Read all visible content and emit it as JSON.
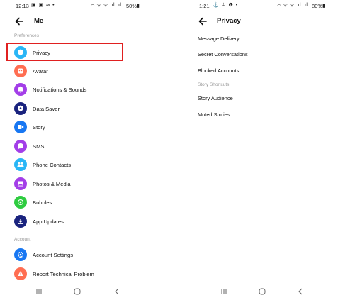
{
  "left": {
    "status": {
      "time": "12:13",
      "icons": "▣ ▣ ʍ •",
      "signal": "⌓ ᯤ ᯤ .ıl .ıl",
      "battery": "50%"
    },
    "appbar": {
      "title": "Me"
    },
    "sections": [
      {
        "header": "Preferences",
        "items": [
          {
            "label": "Privacy",
            "icon": "shield-icon",
            "color": "#29b6f6"
          },
          {
            "label": "Avatar",
            "icon": "avatar-icon",
            "color": "#ff6e52"
          },
          {
            "label": "Notifications & Sounds",
            "icon": "bell-icon",
            "color": "#a33ee8"
          },
          {
            "label": "Data Saver",
            "icon": "data-saver-icon",
            "color": "#1a237e"
          },
          {
            "label": "Story",
            "icon": "story-icon",
            "color": "#1877f2"
          },
          {
            "label": "SMS",
            "icon": "sms-icon",
            "color": "#a33ee8"
          },
          {
            "label": "Phone Contacts",
            "icon": "contacts-icon",
            "color": "#29b6f6"
          },
          {
            "label": "Photos & Media",
            "icon": "photo-icon",
            "color": "#a33ee8"
          },
          {
            "label": "Bubbles",
            "icon": "bubbles-icon",
            "color": "#2ecc40"
          },
          {
            "label": "App Updates",
            "icon": "download-icon",
            "color": "#1a237e"
          }
        ]
      },
      {
        "header": "Account",
        "items": [
          {
            "label": "Account Settings",
            "icon": "gear-icon",
            "color": "#1877f2"
          },
          {
            "label": "Report Technical Problem",
            "icon": "warning-icon",
            "color": "#ff6e52"
          }
        ]
      }
    ]
  },
  "right": {
    "status": {
      "time": "1:21",
      "icons": "⚓ ⇣ ❶ •",
      "signal": "⌓ ᯤ ᯤ .ıl .ıl",
      "battery": "80%"
    },
    "appbar": {
      "title": "Privacy"
    },
    "items": [
      "Message Delivery",
      "Secret Conversations",
      "Blocked Accounts"
    ],
    "section_header": "Story Shortcuts",
    "story_items": [
      "Story Audience",
      "Muted Stories"
    ]
  },
  "highlight_color": "#e02020"
}
